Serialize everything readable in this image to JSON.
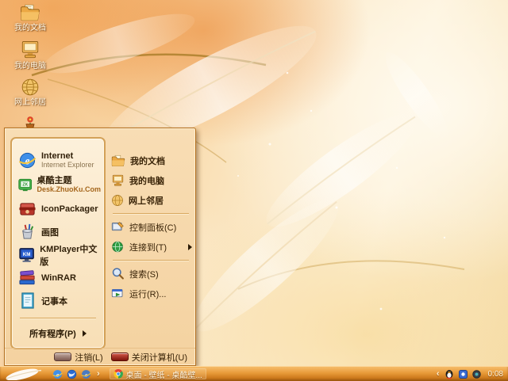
{
  "desktop": {
    "icons": [
      {
        "label": "我的文档",
        "icon": "my-documents-icon"
      },
      {
        "label": "我的电脑",
        "icon": "my-computer-icon"
      },
      {
        "label": "网上邻居",
        "icon": "network-places-icon"
      },
      {
        "label": "",
        "icon": "flowerpot-icon"
      }
    ]
  },
  "start_menu": {
    "left_items": [
      {
        "title": "Internet",
        "subtitle": "Internet Explorer",
        "icon": "internet-explorer-icon"
      },
      {
        "title": "桌酷主题",
        "subtitle": "Desk.ZhuoKu.Com",
        "icon": "zhuoku-theme-icon"
      },
      {
        "title": "IconPackager",
        "icon": "iconpackager-icon"
      },
      {
        "title": "画图",
        "icon": "paint-icon"
      },
      {
        "title": "KMPlayer中文版",
        "icon": "kmplayer-icon"
      },
      {
        "title": "WinRAR",
        "icon": "winrar-icon"
      },
      {
        "title": "记事本",
        "icon": "notepad-icon"
      }
    ],
    "all_programs": "所有程序(P)",
    "right_items_top": [
      {
        "label": "我的文档",
        "icon": "my-documents-folder-icon"
      },
      {
        "label": "我的电脑",
        "icon": "my-computer-icon"
      },
      {
        "label": "网上邻居",
        "icon": "network-globe-icon"
      }
    ],
    "right_items_mid": [
      {
        "label": "控制面板(C)",
        "icon": "control-panel-icon"
      },
      {
        "label": "连接到(T)",
        "icon": "connect-to-icon",
        "has_submenu": true
      }
    ],
    "right_items_bottom": [
      {
        "label": "搜索(S)",
        "icon": "search-icon"
      },
      {
        "label": "运行(R)...",
        "icon": "run-icon"
      }
    ],
    "log_off": "注销(L)",
    "shutdown": "关闭计算机(U)"
  },
  "taskbar": {
    "start_icon": "feather-start-icon",
    "quick_launch_icons": [
      "ie-quicklaunch-icon",
      "globe-quicklaunch-icon",
      "browser-quicklaunch-icon"
    ],
    "task_button": {
      "label": "桌面 - 壁纸 - 桌酷壁...",
      "icon": "chrome-icon"
    },
    "tray_icons": [
      "qq-icon",
      "messenger-tray-icon",
      "volume-tray-icon"
    ],
    "clock": "0:08"
  },
  "colors": {
    "taskbar_orange": "#e79a38",
    "menu_background": "#f7d9ab",
    "menu_border": "#b5701f",
    "text_dark_brown": "#3a2408",
    "zhuoku_orange": "#a5661c",
    "shutdown_red": "#7e140a",
    "logoff_maroon": "#7d5a50"
  }
}
